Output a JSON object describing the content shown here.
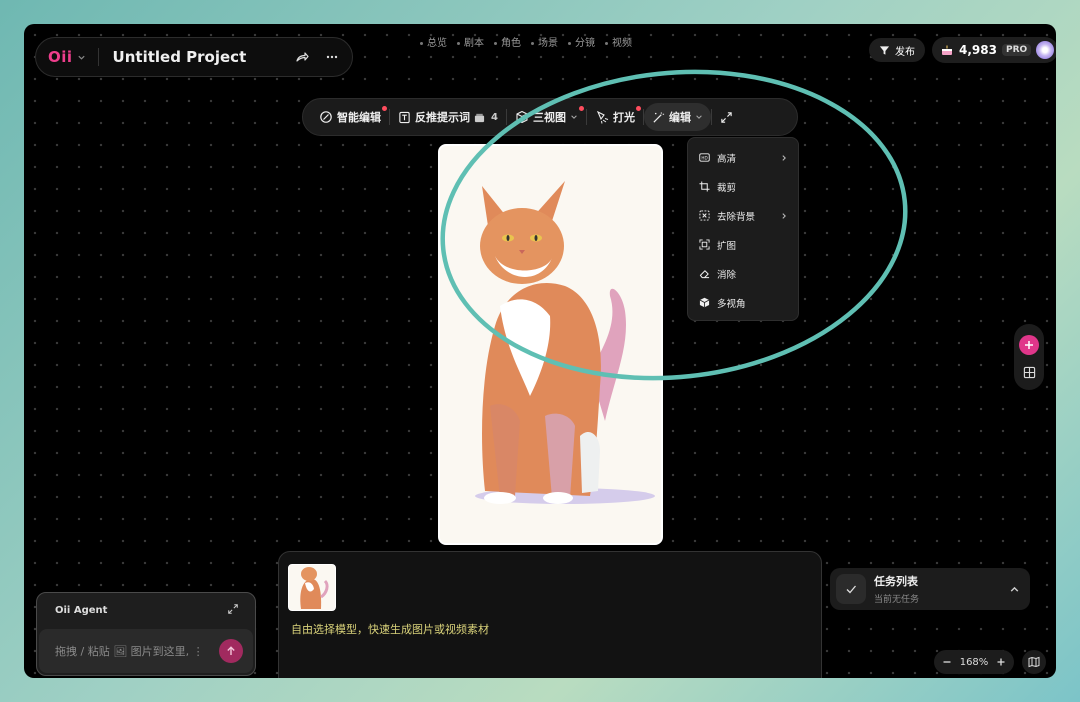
{
  "project": {
    "logo": "Oii",
    "title": "Untitled Project"
  },
  "top_nav": {
    "items": [
      "总览",
      "剧本",
      "角色",
      "场景",
      "分镜",
      "视频"
    ]
  },
  "header_right": {
    "publish_label": "发布",
    "credits": "4,983",
    "plan": "PRO"
  },
  "toolbar": {
    "smart_edit": "智能编辑",
    "reverse_prompt": "反推提示词",
    "reverse_prompt_count": "4",
    "three_view": "三视图",
    "lighting": "打光",
    "edit": "编辑"
  },
  "edit_menu": {
    "items": [
      {
        "label": "高清",
        "icon": "hd-icon",
        "has_submenu": true
      },
      {
        "label": "裁剪",
        "icon": "crop-icon",
        "has_submenu": false
      },
      {
        "label": "去除背景",
        "icon": "remove-bg-icon",
        "has_submenu": true
      },
      {
        "label": "扩图",
        "icon": "expand-image-icon",
        "has_submenu": false
      },
      {
        "label": "消除",
        "icon": "eraser-icon",
        "has_submenu": false
      },
      {
        "label": "多视角",
        "icon": "cube-icon",
        "has_submenu": false
      }
    ]
  },
  "agent": {
    "title": "Oii Agent",
    "placeholder": "拖拽 / 粘贴 🖼 图片到这里, ⋮"
  },
  "generator": {
    "hint": "自由选择模型，快速生成图片或视频素材"
  },
  "tasks": {
    "title": "任务列表",
    "status": "当前无任务"
  },
  "zoom": {
    "level": "168%"
  },
  "colors": {
    "brand": "#ee3e8c",
    "accent_dot": "#ff4d5e",
    "annotation": "#5fbfb3",
    "hint_text": "#d9d27a"
  }
}
